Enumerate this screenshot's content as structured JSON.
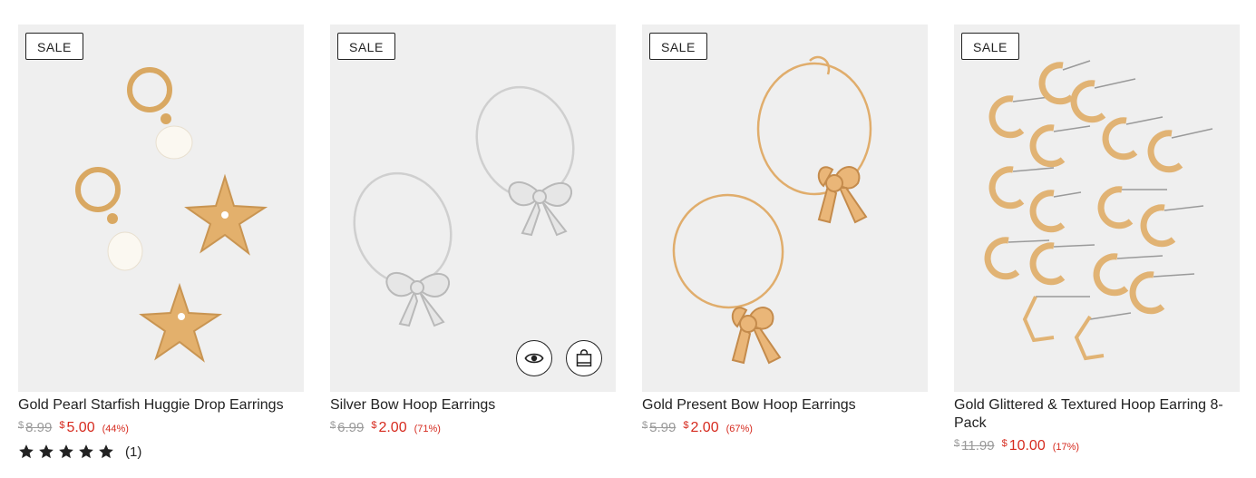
{
  "products": [
    {
      "badge": "SALE",
      "name": "Gold Pearl Starfish Huggie Drop Earrings",
      "currency": "$",
      "original_price": "8.99",
      "sale_price": "5.00",
      "discount": "(44%)",
      "rating": 5,
      "review_count": "(1)"
    },
    {
      "badge": "SALE",
      "name": "Silver Bow Hoop Earrings",
      "currency": "$",
      "original_price": "6.99",
      "sale_price": "2.00",
      "discount": "(71%)",
      "quick_view_icon": "eye-icon",
      "add_to_bag_icon": "shopping-bag-icon"
    },
    {
      "badge": "SALE",
      "name": "Gold Present Bow Hoop Earrings",
      "currency": "$",
      "original_price": "5.99",
      "sale_price": "2.00",
      "discount": "(67%)"
    },
    {
      "badge": "SALE",
      "name": "Gold Glittered & Textured Hoop Earring 8-Pack",
      "currency": "$",
      "original_price": "11.99",
      "sale_price": "10.00",
      "discount": "(17%)"
    }
  ],
  "colors": {
    "sale_price": "#d62b1f",
    "original_price": "#9a9a9a",
    "text": "#222222",
    "image_bg": "#efefef",
    "gold": "#e2b36f",
    "silver": "#d9d9d9"
  }
}
